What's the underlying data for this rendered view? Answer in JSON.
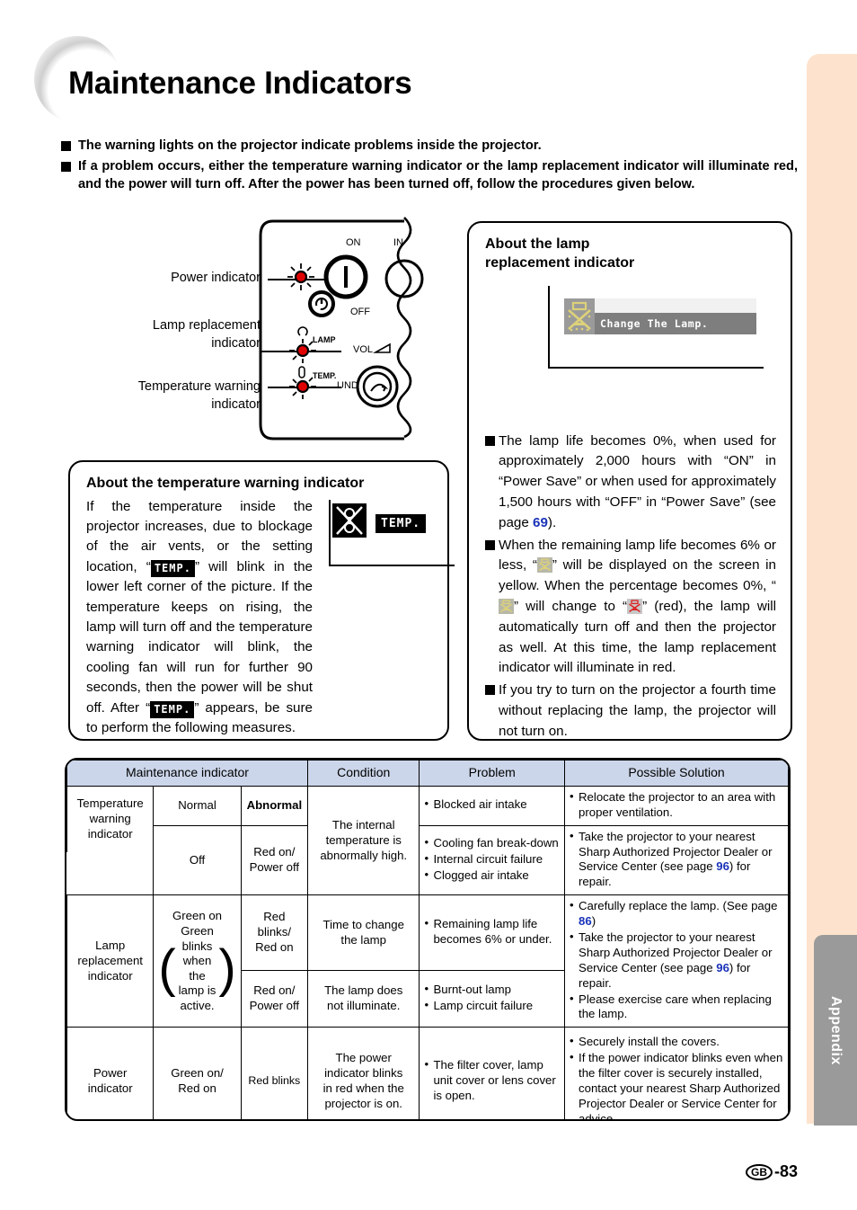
{
  "page": {
    "title": "Maintenance Indicators",
    "footer_region": "GB",
    "footer_page": "-83",
    "side_tab": "Appendix"
  },
  "intro": {
    "bullets": [
      "The warning lights on the projector indicate problems inside the projector.",
      "If a problem occurs, either the temperature warning indicator or the lamp replacement indicator will illuminate red, and the power will turn off. After the power has been turned off, follow the procedures given below."
    ]
  },
  "diagram": {
    "labels": [
      "Power indicator",
      "Lamp replacement\nindicator",
      "Temperature warning\nindicator"
    ],
    "label_power": "Power indicator",
    "label_lamp_l1": "Lamp replacement",
    "label_lamp_l2": "indicator",
    "label_temp_l1": "Temperature warning",
    "label_temp_l2": "indicator",
    "panel_marks": {
      "on": "ON",
      "off": "OFF",
      "input": "IN",
      "lamp": "LAMP",
      "temp": "TEMP.",
      "vol": "VOL",
      "undo": "UNDO"
    }
  },
  "temp_box": {
    "title": "About the temperature warning indicator",
    "body_1": "If the temperature inside the projector increases, due to blockage of the air vents, or the setting location, “",
    "chip_1": "TEMP.",
    "body_2": "” will blink in the lower left corner of the picture. If the temperature keeps on rising, the lamp will turn off and the temperature warning indicator will blink, the cooling fan will run for further 90 seconds, then the power will be shut off. After “",
    "chip_2": "TEMP.",
    "body_3": "” appears, be sure to perform the following measures.",
    "osd_chip": "TEMP."
  },
  "lamp_box": {
    "title_l1": "About the lamp",
    "title_l2": "replacement indicator",
    "osd_message": "Change The Lamp.",
    "bullets": [
      {
        "parts": [
          {
            "t": "text",
            "v": "The lamp life becomes 0%, when used for approximately 2,000 hours with “ON” in “Power Save” or when used for approximately 1,500 hours with “OFF” in “Power Save” (see page "
          },
          {
            "t": "blue",
            "v": "69"
          },
          {
            "t": "text",
            "v": ")."
          }
        ]
      },
      {
        "parts": [
          {
            "t": "text",
            "v": "When the remaining lamp life becomes 6% or less, “"
          },
          {
            "t": "icon-yellow",
            "v": "lamp-x-icon"
          },
          {
            "t": "text",
            "v": "” will be displayed on the screen in yellow. When the percentage becomes 0%, “"
          },
          {
            "t": "icon-yellow",
            "v": "lamp-x-icon"
          },
          {
            "t": "text",
            "v": "” will change to “"
          },
          {
            "t": "icon-red",
            "v": "lamp-x-icon-red"
          },
          {
            "t": "text",
            "v": "” (red), the lamp will automatically turn off and then the projector as well. At this time, the lamp replacement indicator will illuminate in red."
          }
        ]
      },
      {
        "parts": [
          {
            "t": "text",
            "v": "If you try to turn on the projector a fourth time without replacing the lamp, the projector will not turn on."
          }
        ]
      }
    ]
  },
  "table": {
    "headers": {
      "maintenance_indicator": "Maintenance indicator",
      "condition": "Condition",
      "problem": "Problem",
      "possible_solution": "Possible Solution",
      "normal": "Normal",
      "abnormal": "Abnormal"
    },
    "rows": {
      "temperature": {
        "name": "Temperature\nwarning\nindicator",
        "name_l1": "Temperature",
        "name_l2": "warning",
        "name_l3": "indicator",
        "normal": "Off",
        "abnormal_l1": "Red on/",
        "abnormal_l2": "Power off",
        "condition_l1": "The internal",
        "condition_l2": "temperature is",
        "condition_l3": "abnormally high.",
        "problems_a": [
          "Blocked air intake"
        ],
        "solutions_a": [
          "Relocate the projector to an area with proper ventilation."
        ],
        "problems_b": [
          "Cooling fan break-down",
          "Internal circuit failure",
          "Clogged air intake"
        ],
        "solutions_b_pre": "Take the projector to your nearest Sharp Authorized Projector Dealer or Service Center (see page ",
        "solutions_b_page": "96",
        "solutions_b_post": ") for repair."
      },
      "lamp": {
        "name_l1": "Lamp",
        "name_l2": "replacement",
        "name_l3": "indicator",
        "normal_top": "Green on",
        "normal_brace": "Green\nblinks\nwhen the\nlamp is\nactive.",
        "abnormal_1_l1": "Red blinks/",
        "abnormal_1_l2": "Red on",
        "condition_1_l1": "Time to change",
        "condition_1_l2": "the lamp",
        "problems_1": [
          "Remaining lamp life becomes 6% or under."
        ],
        "abnormal_2_l1": "Red on/",
        "abnormal_2_l2": "Power off",
        "condition_2_l1": "The lamp does",
        "condition_2_l2": "not illuminate.",
        "problems_2": [
          "Burnt-out lamp",
          "Lamp circuit failure"
        ],
        "solution_1_pre": "Carefully replace the lamp. (See page ",
        "solution_1_page": "86",
        "solution_1_post": ")",
        "solution_2_pre": "Take the projector to your nearest Sharp Authorized Projector Dealer or Service Center (see page ",
        "solution_2_page": "96",
        "solution_2_post": ") for repair.",
        "solution_3": "Please exercise care when replacing the lamp."
      },
      "power": {
        "name_l1": "Power",
        "name_l2": "indicator",
        "normal_l1": "Green on/",
        "normal_l2": "Red on",
        "abnormal": "Red blinks",
        "condition_l1": "The power",
        "condition_l2": "indicator blinks",
        "condition_l3": "in red when the",
        "condition_l4": "projector is on.",
        "problems": [
          "The filter cover, lamp unit cover or lens cover is open."
        ],
        "solutions": [
          "Securely install the covers.",
          "If the power indicator blinks even when the filter cover is securely installed, contact your nearest Sharp Authorized Projector Dealer or Service Center for advice."
        ]
      }
    }
  },
  "colors": {
    "table_header_bg": "#ccd6ea",
    "side_band": "#fde3cd",
    "appendix_tab": "#9a9a9a",
    "page_ref_blue": "#1a33b8",
    "indicator_red": "#e00000",
    "osd_yellow": "#ddd17a"
  }
}
